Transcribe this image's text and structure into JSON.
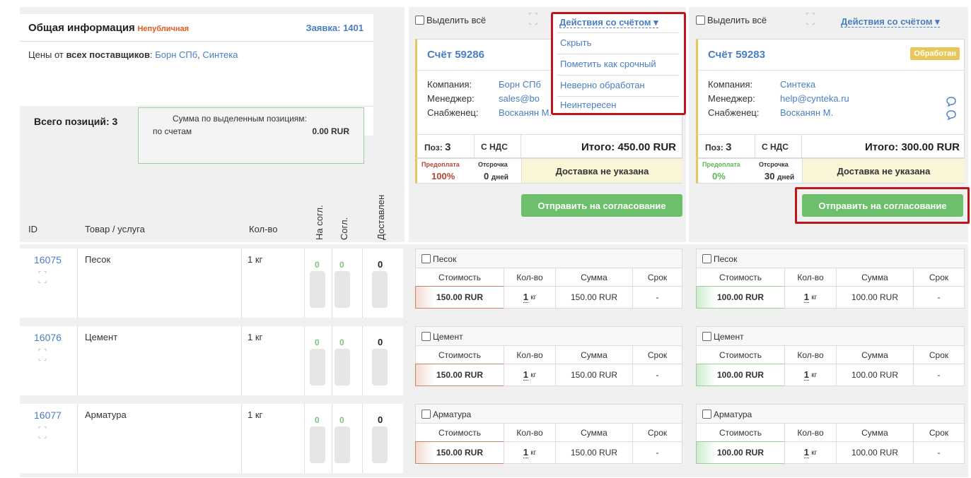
{
  "info": {
    "title": "Общая информация",
    "badge": "Непубличная",
    "request_label": "Заявка: 1401",
    "prices_prefix": "Цены от ",
    "prices_bold": "всех поставщиков",
    "prices_colon": ": ",
    "supplier1": "Борн СПб",
    "supplier_sep": ", ",
    "supplier2": "Синтека",
    "total_label": "Всего позиций: ",
    "total_value": "3",
    "sum_title": "Сумма по выделенным позициям:",
    "sum_by": "по счетам",
    "sum_value": "0.00 RUR"
  },
  "table_header": {
    "id": "ID",
    "item": "Товар / услуга",
    "qty": "Кол-во",
    "on_approval": "На согл.",
    "approved": "Согл.",
    "delivered": "Доставлен"
  },
  "rows": [
    {
      "id": "16075",
      "name": "Песок",
      "qty": "1 кг",
      "a": "0",
      "b": "0",
      "c": "0"
    },
    {
      "id": "16076",
      "name": "Цемент",
      "qty": "1 кг",
      "a": "0",
      "b": "0",
      "c": "0"
    },
    {
      "id": "16077",
      "name": "Арматура",
      "qty": "1 кг",
      "a": "0",
      "b": "0",
      "c": "0"
    }
  ],
  "invoices": [
    {
      "select_all": "Выделить всё",
      "actions": "Действия со счётом ▾",
      "title": "Счёт 59286",
      "status": "",
      "company_label": "Компания:",
      "company": "Борн СПб",
      "manager_label": "Менеджер:",
      "manager": "sales@bo",
      "buyer_label": "Снабженец:",
      "buyer": "Восканян М.",
      "pos_label": "Поз:",
      "pos_value": "3",
      "vat": "С НДС",
      "total": "Итого: 450.00 RUR",
      "prepay_label": "Предоплата",
      "prepay_value": "100%",
      "delay_label": "Отсрочка",
      "delay_value": "0",
      "delay_unit": "дней",
      "delivery": "Доставка не указана",
      "send": "Отправить на согласование",
      "items": [
        {
          "name": "Песок",
          "h_cost": "Стоимость",
          "h_qty": "Кол-во",
          "h_sum": "Сумма",
          "h_term": "Срок",
          "cost": "150.00 RUR",
          "qty": "1",
          "unit": "кг",
          "sum": "150.00 RUR",
          "term": "-"
        },
        {
          "name": "Цемент",
          "h_cost": "Стоимость",
          "h_qty": "Кол-во",
          "h_sum": "Сумма",
          "h_term": "Срок",
          "cost": "150.00 RUR",
          "qty": "1",
          "unit": "кг",
          "sum": "150.00 RUR",
          "term": "-"
        },
        {
          "name": "Арматура",
          "h_cost": "Стоимость",
          "h_qty": "Кол-во",
          "h_sum": "Сумма",
          "h_term": "Срок",
          "cost": "150.00 RUR",
          "qty": "1",
          "unit": "кг",
          "sum": "150.00 RUR",
          "term": "-"
        }
      ]
    },
    {
      "select_all": "Выделить всё",
      "actions": "Действия со счётом ▾",
      "title": "Счёт 59283",
      "status": "Обработан",
      "company_label": "Компания:",
      "company": "Синтека",
      "manager_label": "Менеджер:",
      "manager": "help@cynteka.ru",
      "buyer_label": "Снабженец:",
      "buyer": "Восканян М.",
      "pos_label": "Поз:",
      "pos_value": "3",
      "vat": "С НДС",
      "total": "Итого: 300.00 RUR",
      "prepay_label": "Предоплата",
      "prepay_value": "0%",
      "delay_label": "Отсрочка",
      "delay_value": "30",
      "delay_unit": "дней",
      "delivery": "Доставка не указана",
      "send": "Отправить на согласование",
      "items": [
        {
          "name": "Песок",
          "h_cost": "Стоимость",
          "h_qty": "Кол-во",
          "h_sum": "Сумма",
          "h_term": "Срок",
          "cost": "100.00 RUR",
          "qty": "1",
          "unit": "кг",
          "sum": "100.00 RUR",
          "term": "-"
        },
        {
          "name": "Цемент",
          "h_cost": "Стоимость",
          "h_qty": "Кол-во",
          "h_sum": "Сумма",
          "h_term": "Срок",
          "cost": "100.00 RUR",
          "qty": "1",
          "unit": "кг",
          "sum": "100.00 RUR",
          "term": "-"
        },
        {
          "name": "Арматура",
          "h_cost": "Стоимость",
          "h_qty": "Кол-во",
          "h_sum": "Сумма",
          "h_term": "Срок",
          "cost": "100.00 RUR",
          "qty": "1",
          "unit": "кг",
          "sum": "100.00 RUR",
          "term": "-"
        }
      ]
    }
  ],
  "dropdown": {
    "items": [
      "Скрыть",
      "Пометить как срочный",
      "Неверно обработан",
      "Неинтересен"
    ]
  },
  "colors": {
    "link": "#4a7ec2",
    "badge": "#e05a1e",
    "green_button": "#6cc06c",
    "status_badge": "#e8c75a",
    "highlight_border": "#c0151b",
    "prepay_red": "#b5473a",
    "prepay_green": "#5ab55a"
  }
}
